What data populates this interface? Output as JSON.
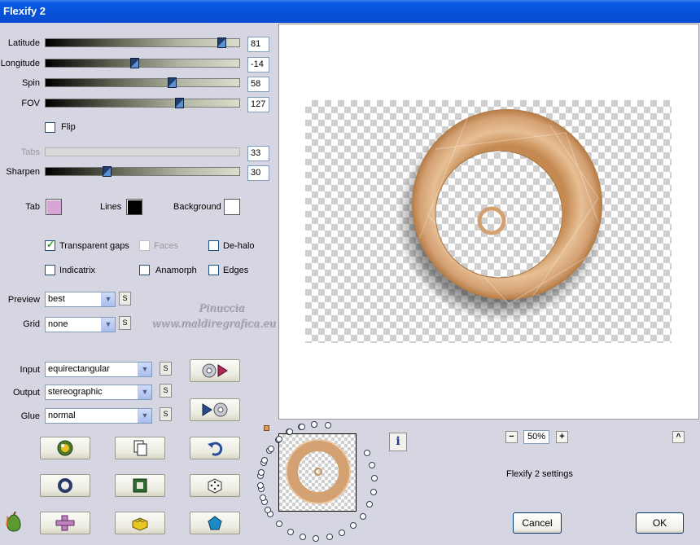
{
  "window": {
    "title": "Flexify 2"
  },
  "sliders": [
    {
      "label": "Latitude",
      "value": "81",
      "fraction": 0.93
    },
    {
      "label": "Longitude",
      "value": "-14",
      "fraction": 0.46
    },
    {
      "label": "Spin",
      "value": "58",
      "fraction": 0.66
    },
    {
      "label": "FOV",
      "value": "127",
      "fraction": 0.7
    },
    {
      "label": "Tabs",
      "value": "33",
      "fraction": 0.0,
      "disabled": true
    },
    {
      "label": "Sharpen",
      "value": "30",
      "fraction": 0.31
    }
  ],
  "flip": {
    "label": "Flip",
    "checked": false
  },
  "colors": {
    "tab": {
      "label": "Tab",
      "color": "#d8a6d6"
    },
    "lines": {
      "label": "Lines",
      "color": "#000000"
    },
    "background": {
      "label": "Background",
      "color": "#ffffff"
    }
  },
  "options": {
    "transparent_gaps": {
      "label": "Transparent gaps",
      "checked": true
    },
    "faces": {
      "label": "Faces",
      "checked": false,
      "disabled": true
    },
    "de_halo": {
      "label": "De-halo",
      "checked": false
    },
    "indicatrix": {
      "label": "Indicatrix",
      "checked": false
    },
    "anamorph": {
      "label": "Anamorph",
      "checked": false
    },
    "edges": {
      "label": "Edges",
      "checked": false
    }
  },
  "selects": {
    "preview": {
      "label": "Preview",
      "value": "best"
    },
    "grid": {
      "label": "Grid",
      "value": "none"
    },
    "input": {
      "label": "Input",
      "value": "equirectangular"
    },
    "output": {
      "label": "Output",
      "value": "stereographic"
    },
    "glue": {
      "label": "Glue",
      "value": "normal"
    }
  },
  "s_button_label": "S",
  "watermark": {
    "line1": "Pinuccia",
    "line2": "www.maldiregrafica.eu"
  },
  "zoom": {
    "minus": "−",
    "value": "50%",
    "plus": "+"
  },
  "up_button": "^",
  "info_button": "i",
  "settings_label": "Flexify 2 settings",
  "buttons": {
    "cancel": "Cancel",
    "ok": "OK"
  }
}
